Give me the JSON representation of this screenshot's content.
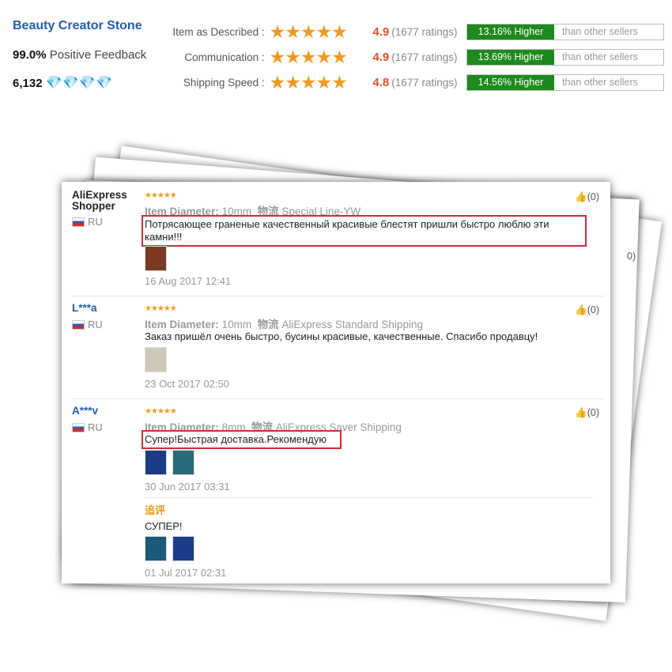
{
  "seller": {
    "name": "Beauty Creator Stone",
    "positive_pct": "99.0%",
    "positive_label": "Positive Feedback",
    "score": "6,132",
    "diamond_count": 4
  },
  "ratings": [
    {
      "label": "Item as Described :",
      "stars": 4.9,
      "value": "4.9",
      "count": "(1677 ratings)",
      "higher": "13.16% Higher",
      "than": "than other sellers"
    },
    {
      "label": "Communication :",
      "stars": 4.9,
      "value": "4.9",
      "count": "(1677 ratings)",
      "higher": "13.69% Higher",
      "than": "than other sellers"
    },
    {
      "label": "Shipping Speed :",
      "stars": 4.8,
      "value": "4.8",
      "count": "(1677 ratings)",
      "higher": "14.56% Higher",
      "than": "than other sellers"
    }
  ],
  "colors": {
    "brand": "#1e5fb4",
    "star": "#f39a1e",
    "higher": "#1c8a1c",
    "highlight_box": "#d42a35"
  },
  "background_likes": [
    "0)",
    "0)"
  ],
  "reviews": [
    {
      "user": "AliExpress Shopper",
      "country": "RU",
      "stars": "★★★★★",
      "attr_label": "Item Diameter:",
      "attr_value": "10mm",
      "ship_label": "物流",
      "shipping": "Special Line-YW",
      "text": "Потрясающее граненые качественный красивые блестят пришли быстро люблю эти камни!!!",
      "date": "16 Aug 2017 12:41",
      "likes": "(0)"
    },
    {
      "user": "L***a",
      "country": "RU",
      "stars": "★★★★★",
      "attr_label": "Item Diameter:",
      "attr_value": "10mm",
      "ship_label": "物流",
      "shipping": "AliExpress Standard Shipping",
      "text": "Заказ пришёл очень быстро, бусины красивые, качественные. Спасибо продавцу!",
      "date": "23 Oct 2017 02:50",
      "likes": "(0)"
    },
    {
      "user": "A***v",
      "country": "RU",
      "stars": "★★★★★",
      "attr_label": "Item Diameter:",
      "attr_value": "8mm",
      "ship_label": "物流",
      "shipping": "AliExpress Saver Shipping",
      "text": "Супер!Быстрая доставка.Рекомендую",
      "date": "30 Jun 2017 03:31",
      "likes": "(0)",
      "followup": {
        "label": "追评",
        "text": "СУПЕР!",
        "date": "01 Jul 2017 02:31"
      }
    }
  ]
}
